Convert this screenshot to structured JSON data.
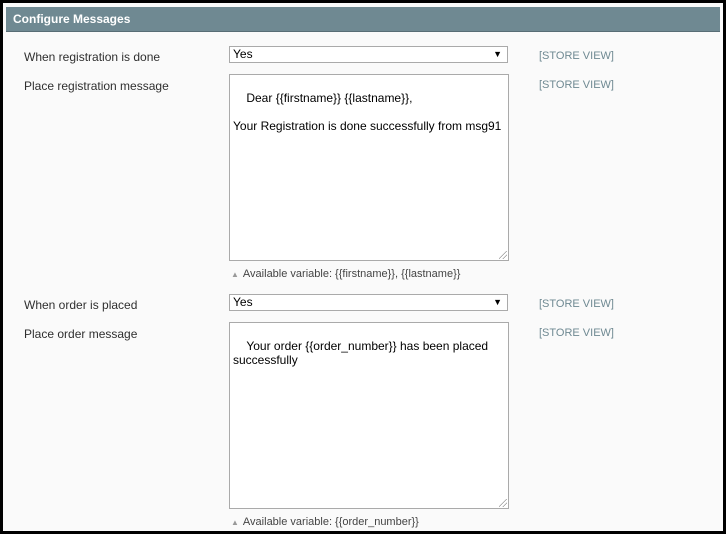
{
  "section": {
    "title": "Configure Messages"
  },
  "rows": {
    "registration_done": {
      "label": "When registration is done",
      "value": "Yes",
      "scope": "[STORE VIEW]"
    },
    "registration_message": {
      "label": "Place registration message",
      "value": "Dear {{firstname}} {{lastname}},\n\nYour Registration is done successfully from msg91",
      "scope": "[STORE VIEW]",
      "note": "Available variable: {{firstname}}, {{lastname}}"
    },
    "order_placed": {
      "label": "When order is placed",
      "value": "Yes",
      "scope": "[STORE VIEW]"
    },
    "order_message": {
      "label": "Place order message",
      "value": "Your order {{order_number}} has been placed successfully",
      "scope": "[STORE VIEW]",
      "note": "Available variable: {{order_number}}"
    }
  },
  "icons": {
    "dropdown": "chevron-down-icon",
    "hint": "triangle-up-icon",
    "resize": "resize-handle-icon"
  },
  "colors": {
    "header": "#6f8992",
    "scope_text": "#6f8992"
  }
}
